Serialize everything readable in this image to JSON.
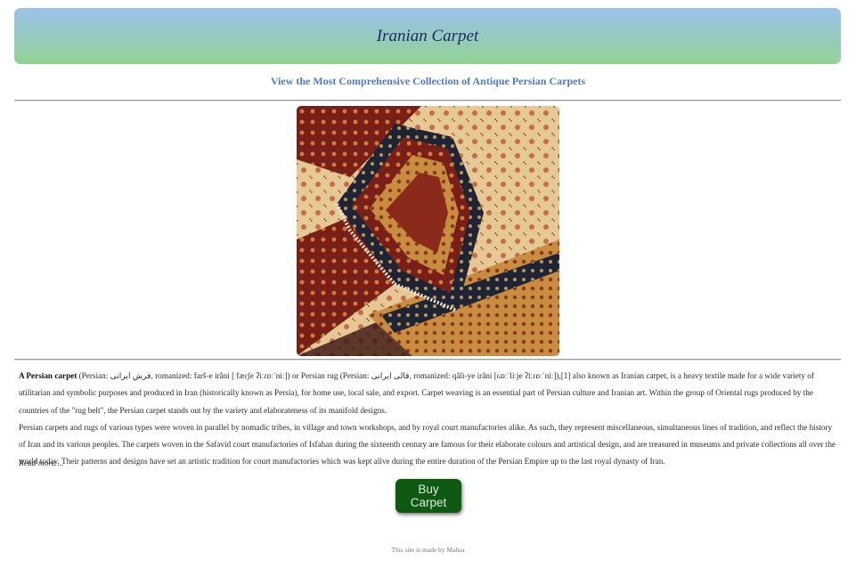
{
  "header": {
    "title": "Iranian Carpet"
  },
  "subtitle": "View the Most Comprehensive Collection of Antique Persian Carpets",
  "image": {
    "alt": "Persian carpets"
  },
  "article": {
    "p1_bold": "A Persian carpet",
    "p1_text": " (Persian: فرش ایرانی, romanized: farš-e irâni [ fæɾʃe ʔiːɾɒːˈniː]) or Persian rug (Persian: قالی ایرانی, romanized: qâli-ye irâni [ɢɒːˈliːje ʔiːɾɒːˈniː]),[1] also known as Iranian carpet, is a heavy textile made for a wide variety of utilitarian and symbolic purposes and produced in Iran (historically known as Persia), for home use, local sale, and export. Carpet weaving is an essential part of Persian culture and Iranian art. Within the group of Oriental rugs produced by the countries of the \"rug belt\", the Persian carpet stands out by the variety and elaborateness of its manifold designs.",
    "p2_text": "Persian carpets and rugs of various types were woven in parallel by nomadic tribes, in village and town workshops, and by royal court manufactories alike. As such, they represent miscellaneous, simultaneous lines of tradition, and reflect the history of Iran and its various peoples. The carpets woven in the Safavid court manufactories of Isfahan during the sixteenth century are famous for their elaborate colours and artistical design, and are treasured in museums and private collections all over the world today. Their patterns and designs have set an artistic tradition for court manufactories which was kept alive during the entire duration of the Persian Empire up to the last royal dynasty of Iran.",
    "read_more": "Read more ..."
  },
  "buy_button": {
    "label": "Buy Carpet",
    "color": "#0f5a13"
  },
  "footer": "This site is made by Mahsa",
  "colors": {
    "header_top": "#99c2ea",
    "header_bottom": "#92d394",
    "title": "#1d2a64",
    "subtitle": "#4f7ac9"
  }
}
